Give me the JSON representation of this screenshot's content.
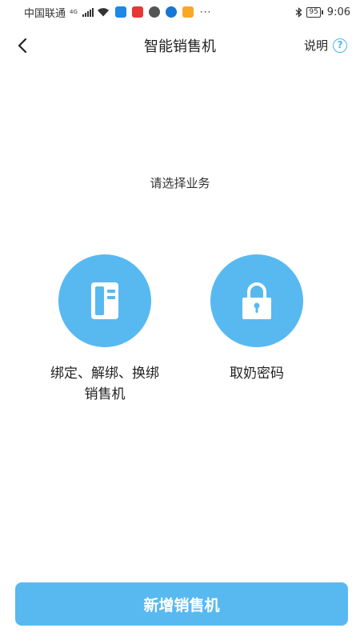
{
  "status_bar": {
    "carrier": "中国联通",
    "network": "4G",
    "battery": "95",
    "time": "9:06",
    "more": "···"
  },
  "header": {
    "title": "智能销售机",
    "help_label": "说明",
    "help_icon_glyph": "?"
  },
  "main": {
    "prompt": "请选择业务",
    "options": [
      {
        "label_line1": "绑定、解绑、换绑",
        "label_line2": "销售机",
        "icon": "vending-machine-icon"
      },
      {
        "label_line1": "取奶密码",
        "label_line2": "",
        "icon": "lock-icon"
      }
    ]
  },
  "footer": {
    "add_button_label": "新增销售机"
  },
  "colors": {
    "accent": "#58b9f1",
    "help_accent": "#4db6ec"
  }
}
